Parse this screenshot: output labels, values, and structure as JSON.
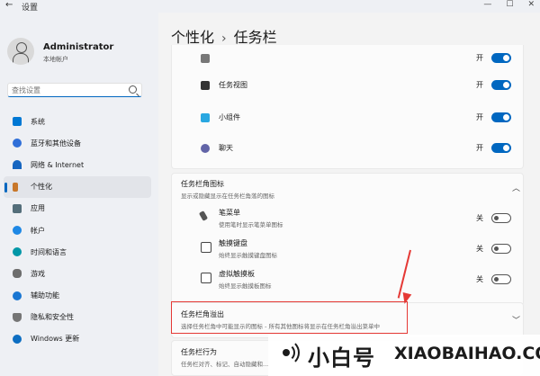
{
  "window": {
    "title": "设置"
  },
  "user": {
    "name": "Administrator",
    "subtitle": "本地帐户"
  },
  "search": {
    "placeholder": "查找设置"
  },
  "nav": [
    {
      "label": "系统",
      "color": "#0078d4"
    },
    {
      "label": "蓝牙和其他设备",
      "color": "#2f6fd8"
    },
    {
      "label": "网络 & Internet",
      "color": "#1565c0"
    },
    {
      "label": "个性化",
      "color": "#c8772a"
    },
    {
      "label": "应用",
      "color": "#546e7a"
    },
    {
      "label": "帐户",
      "color": "#1e88e5"
    },
    {
      "label": "时间和语言",
      "color": "#0097a7"
    },
    {
      "label": "游戏",
      "color": "#6d6d6d"
    },
    {
      "label": "辅助功能",
      "color": "#1976d2"
    },
    {
      "label": "隐私和安全性",
      "color": "#757575"
    },
    {
      "label": "Windows 更新",
      "color": "#0d6ec2"
    }
  ],
  "breadcrumb": {
    "parent": "个性化",
    "current": "任务栏"
  },
  "taskbar_items": [
    {
      "label": "",
      "state": "开"
    },
    {
      "label": "任务视图",
      "state": "开"
    },
    {
      "label": "小组件",
      "state": "开"
    },
    {
      "label": "聊天",
      "state": "开"
    }
  ],
  "corner_icons": {
    "title": "任务栏角图标",
    "subtitle": "显示或隐藏显示在任务栏角落的图标",
    "items": [
      {
        "label": "笔菜单",
        "sub": "使用笔时显示笔菜单图标",
        "state": "关"
      },
      {
        "label": "触摸键盘",
        "sub": "始终显示触摸键盘图标",
        "state": "关"
      },
      {
        "label": "虚拟触摸板",
        "sub": "始终显示触摸板图标",
        "state": "关"
      }
    ]
  },
  "overflow": {
    "title": "任务栏角溢出",
    "subtitle": "选择任务栏角中可能显示的图标 - 所有其他图标将显示在任务栏角溢出菜单中"
  },
  "behavior": {
    "title": "任务栏行为",
    "subtitle": "任务栏对齐、标记、自动隐藏和..."
  },
  "brand": {
    "cn": "小白号",
    "en": "XIAOBAIHAO.COM"
  },
  "colors": {
    "accent": "#0067c0",
    "annotation": "#e53935"
  }
}
